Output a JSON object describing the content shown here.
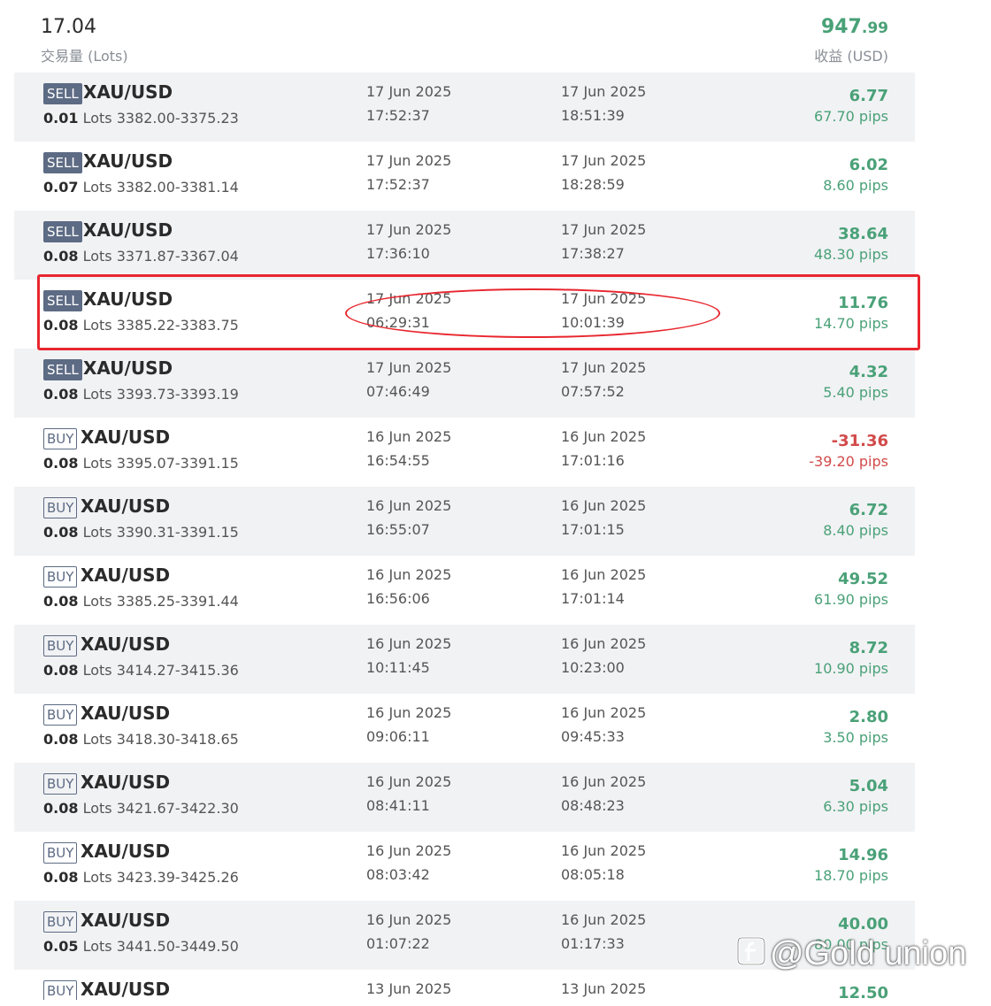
{
  "summary": {
    "total_lots": "17.04",
    "lots_label": "交易量 (Lots)",
    "profit_int": "947",
    "profit_dec": ".99",
    "profit_label": "收益 (USD)"
  },
  "trades": [
    {
      "side": "SELL",
      "symbol": "XAU/USD",
      "lots": "0.01",
      "lots_unit": "Lots",
      "price": "3382.00-3375.23",
      "open_date": "17 Jun 2025",
      "open_time": "17:52:37",
      "close_date": "17 Jun 2025",
      "close_time": "18:51:39",
      "profit": "6.77",
      "pips": "67.70 pips",
      "positive": true
    },
    {
      "side": "SELL",
      "symbol": "XAU/USD",
      "lots": "0.07",
      "lots_unit": "Lots",
      "price": "3382.00-3381.14",
      "open_date": "17 Jun 2025",
      "open_time": "17:52:37",
      "close_date": "17 Jun 2025",
      "close_time": "18:28:59",
      "profit": "6.02",
      "pips": "8.60 pips",
      "positive": true
    },
    {
      "side": "SELL",
      "symbol": "XAU/USD",
      "lots": "0.08",
      "lots_unit": "Lots",
      "price": "3371.87-3367.04",
      "open_date": "17 Jun 2025",
      "open_time": "17:36:10",
      "close_date": "17 Jun 2025",
      "close_time": "17:38:27",
      "profit": "38.64",
      "pips": "48.30 pips",
      "positive": true
    },
    {
      "side": "SELL",
      "symbol": "XAU/USD",
      "lots": "0.08",
      "lots_unit": "Lots",
      "price": "3385.22-3383.75",
      "open_date": "17 Jun 2025",
      "open_time": "06:29:31",
      "close_date": "17 Jun 2025",
      "close_time": "10:01:39",
      "profit": "11.76",
      "pips": "14.70 pips",
      "positive": true
    },
    {
      "side": "SELL",
      "symbol": "XAU/USD",
      "lots": "0.08",
      "lots_unit": "Lots",
      "price": "3393.73-3393.19",
      "open_date": "17 Jun 2025",
      "open_time": "07:46:49",
      "close_date": "17 Jun 2025",
      "close_time": "07:57:52",
      "profit": "4.32",
      "pips": "5.40 pips",
      "positive": true
    },
    {
      "side": "BUY",
      "symbol": "XAU/USD",
      "lots": "0.08",
      "lots_unit": "Lots",
      "price": "3395.07-3391.15",
      "open_date": "16 Jun 2025",
      "open_time": "16:54:55",
      "close_date": "16 Jun 2025",
      "close_time": "17:01:16",
      "profit": "-31.36",
      "pips": "-39.20 pips",
      "positive": false
    },
    {
      "side": "BUY",
      "symbol": "XAU/USD",
      "lots": "0.08",
      "lots_unit": "Lots",
      "price": "3390.31-3391.15",
      "open_date": "16 Jun 2025",
      "open_time": "16:55:07",
      "close_date": "16 Jun 2025",
      "close_time": "17:01:15",
      "profit": "6.72",
      "pips": "8.40 pips",
      "positive": true
    },
    {
      "side": "BUY",
      "symbol": "XAU/USD",
      "lots": "0.08",
      "lots_unit": "Lots",
      "price": "3385.25-3391.44",
      "open_date": "16 Jun 2025",
      "open_time": "16:56:06",
      "close_date": "16 Jun 2025",
      "close_time": "17:01:14",
      "profit": "49.52",
      "pips": "61.90 pips",
      "positive": true
    },
    {
      "side": "BUY",
      "symbol": "XAU/USD",
      "lots": "0.08",
      "lots_unit": "Lots",
      "price": "3414.27-3415.36",
      "open_date": "16 Jun 2025",
      "open_time": "10:11:45",
      "close_date": "16 Jun 2025",
      "close_time": "10:23:00",
      "profit": "8.72",
      "pips": "10.90 pips",
      "positive": true
    },
    {
      "side": "BUY",
      "symbol": "XAU/USD",
      "lots": "0.08",
      "lots_unit": "Lots",
      "price": "3418.30-3418.65",
      "open_date": "16 Jun 2025",
      "open_time": "09:06:11",
      "close_date": "16 Jun 2025",
      "close_time": "09:45:33",
      "profit": "2.80",
      "pips": "3.50 pips",
      "positive": true
    },
    {
      "side": "BUY",
      "symbol": "XAU/USD",
      "lots": "0.08",
      "lots_unit": "Lots",
      "price": "3421.67-3422.30",
      "open_date": "16 Jun 2025",
      "open_time": "08:41:11",
      "close_date": "16 Jun 2025",
      "close_time": "08:48:23",
      "profit": "5.04",
      "pips": "6.30 pips",
      "positive": true
    },
    {
      "side": "BUY",
      "symbol": "XAU/USD",
      "lots": "0.08",
      "lots_unit": "Lots",
      "price": "3423.39-3425.26",
      "open_date": "16 Jun 2025",
      "open_time": "08:03:42",
      "close_date": "16 Jun 2025",
      "close_time": "08:05:18",
      "profit": "14.96",
      "pips": "18.70 pips",
      "positive": true
    },
    {
      "side": "BUY",
      "symbol": "XAU/USD",
      "lots": "0.05",
      "lots_unit": "Lots",
      "price": "3441.50-3449.50",
      "open_date": "16 Jun 2025",
      "open_time": "01:07:22",
      "close_date": "16 Jun 2025",
      "close_time": "01:17:33",
      "profit": "40.00",
      "pips": "80.00 pips",
      "positive": true
    },
    {
      "side": "BUY",
      "symbol": "XAU/USD",
      "lots": "",
      "lots_unit": "",
      "price": "",
      "open_date": "13 Jun 2025",
      "open_time": "",
      "close_date": "13 Jun 2025",
      "close_time": "",
      "profit": "12.50",
      "pips": "",
      "positive": true
    }
  ],
  "colors": {
    "profit_positive": "#4aa178",
    "profit_negative": "#d24a4a",
    "badge": "#5d6b84",
    "highlight": "#e8262e"
  },
  "watermark": {
    "text": "@Gold union",
    "icon": "brand-logo-icon"
  }
}
